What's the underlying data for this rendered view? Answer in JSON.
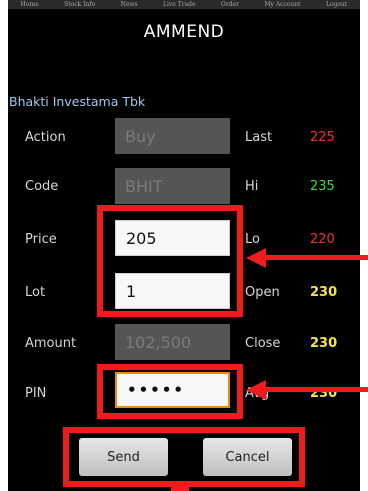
{
  "nav": {
    "items": [
      "Home",
      "Stock Info",
      "News",
      "Live Trade",
      "Order",
      "My Account",
      "Logout"
    ]
  },
  "title": "AMMEND",
  "company": "Bhakti Investama Tbk",
  "form": {
    "action_label": "Buy",
    "action_value": "Buy",
    "code_label": "Code",
    "code_value": "BHIT",
    "price_label": "Price",
    "price_value": "205",
    "lot_label": "Lot",
    "lot_value": "1",
    "amount_label": "Amount",
    "amount_value": "102,500",
    "pin_label": "PIN",
    "pin_value": "•••••"
  },
  "quote": {
    "last_label": "Last",
    "last_value": "225",
    "hi_label": "Hi",
    "hi_value": "235",
    "lo_label": "Lo",
    "lo_value": "220",
    "open_label": "Open",
    "open_value": "230",
    "close_label": "Close",
    "close_value": "230",
    "avg_label": "Avg",
    "avg_value": "230"
  },
  "buttons": {
    "send": "Send",
    "cancel": "Cancel"
  },
  "colors": {
    "annotation": "#ee1c1c",
    "pin_focus": "#f08a00",
    "last": "#ff2a2a",
    "hi": "#33dd33",
    "lo": "#ff2a2a",
    "ohlc": "#f5e642"
  }
}
